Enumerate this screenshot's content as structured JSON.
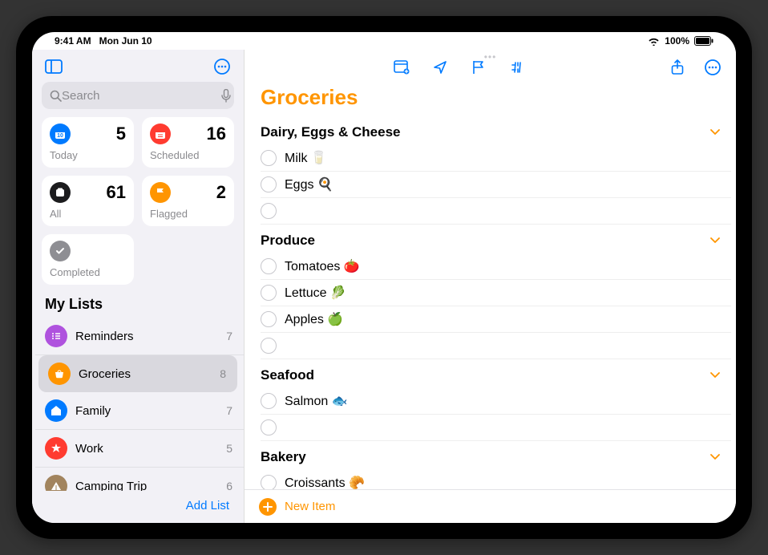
{
  "status": {
    "time": "9:41 AM",
    "date": "Mon Jun 10",
    "battery": "100%"
  },
  "search": {
    "placeholder": "Search"
  },
  "smart": [
    {
      "id": "today",
      "label": "Today",
      "count": "5",
      "bg": "bg-blue"
    },
    {
      "id": "scheduled",
      "label": "Scheduled",
      "count": "16",
      "bg": "bg-red"
    },
    {
      "id": "all",
      "label": "All",
      "count": "61",
      "bg": "bg-dark"
    },
    {
      "id": "flagged",
      "label": "Flagged",
      "count": "2",
      "bg": "bg-orange"
    },
    {
      "id": "completed",
      "label": "Completed",
      "count": "",
      "bg": "bg-grey"
    }
  ],
  "mylists_header": "My Lists",
  "lists": [
    {
      "name": "Reminders",
      "count": "7",
      "bg": "bg-purple",
      "selected": false
    },
    {
      "name": "Groceries",
      "count": "8",
      "bg": "bg-orange",
      "selected": true
    },
    {
      "name": "Family",
      "count": "7",
      "bg": "bg-blue",
      "selected": false
    },
    {
      "name": "Work",
      "count": "5",
      "bg": "bg-red",
      "selected": false
    },
    {
      "name": "Camping Trip",
      "count": "6",
      "bg": "bg-brown",
      "selected": false
    }
  ],
  "add_list_label": "Add List",
  "main": {
    "title": "Groceries",
    "new_item_label": "New Item",
    "sections": [
      {
        "name": "Dairy, Eggs & Cheese",
        "items": [
          "Milk 🥛",
          "Eggs 🍳"
        ],
        "blank": true
      },
      {
        "name": "Produce",
        "items": [
          "Tomatoes 🍅",
          "Lettuce 🥬",
          "Apples 🍏"
        ],
        "blank": true
      },
      {
        "name": "Seafood",
        "items": [
          "Salmon 🐟"
        ],
        "blank": true
      },
      {
        "name": "Bakery",
        "items": [
          "Croissants 🥐"
        ],
        "blank": false
      }
    ]
  }
}
